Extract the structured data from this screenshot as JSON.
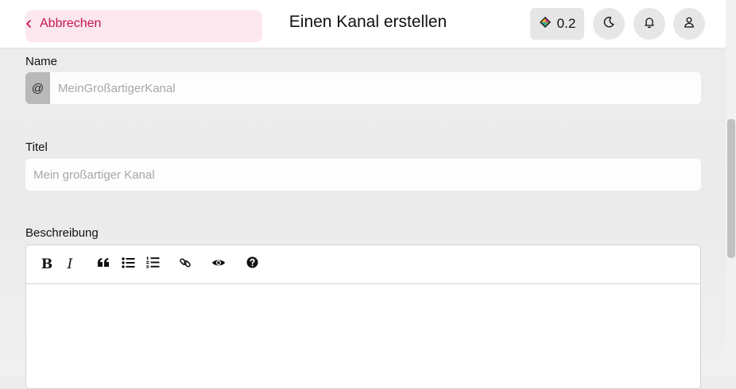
{
  "header": {
    "back_label": "Abbrechen",
    "title": "Einen Kanal erstellen",
    "version": "0.2",
    "theme_icon": "moon-icon",
    "notifications_icon": "bell-icon",
    "profile_icon": "user-icon"
  },
  "form": {
    "name": {
      "label": "Name",
      "prefix": "@",
      "value": "",
      "placeholder": "MeinGroßartigerKanal"
    },
    "title": {
      "label": "Titel",
      "value": "",
      "placeholder": "Mein großartiger Kanal"
    },
    "description": {
      "label": "Beschreibung",
      "toolbar": [
        {
          "name": "bold",
          "glyph": "B"
        },
        {
          "name": "italic",
          "glyph": "I"
        },
        {
          "name": "quote",
          "icon": "quote-icon"
        },
        {
          "name": "unordered-list",
          "icon": "list-ul-icon"
        },
        {
          "name": "ordered-list",
          "icon": "list-ol-icon"
        },
        {
          "name": "link",
          "icon": "link-icon"
        },
        {
          "name": "preview",
          "icon": "eye-icon"
        },
        {
          "name": "help",
          "icon": "question-circle-icon"
        }
      ]
    }
  },
  "colors": {
    "accent": "#c6154f",
    "page_background": "#ececec",
    "prefix_background": "#b9b9b9"
  }
}
